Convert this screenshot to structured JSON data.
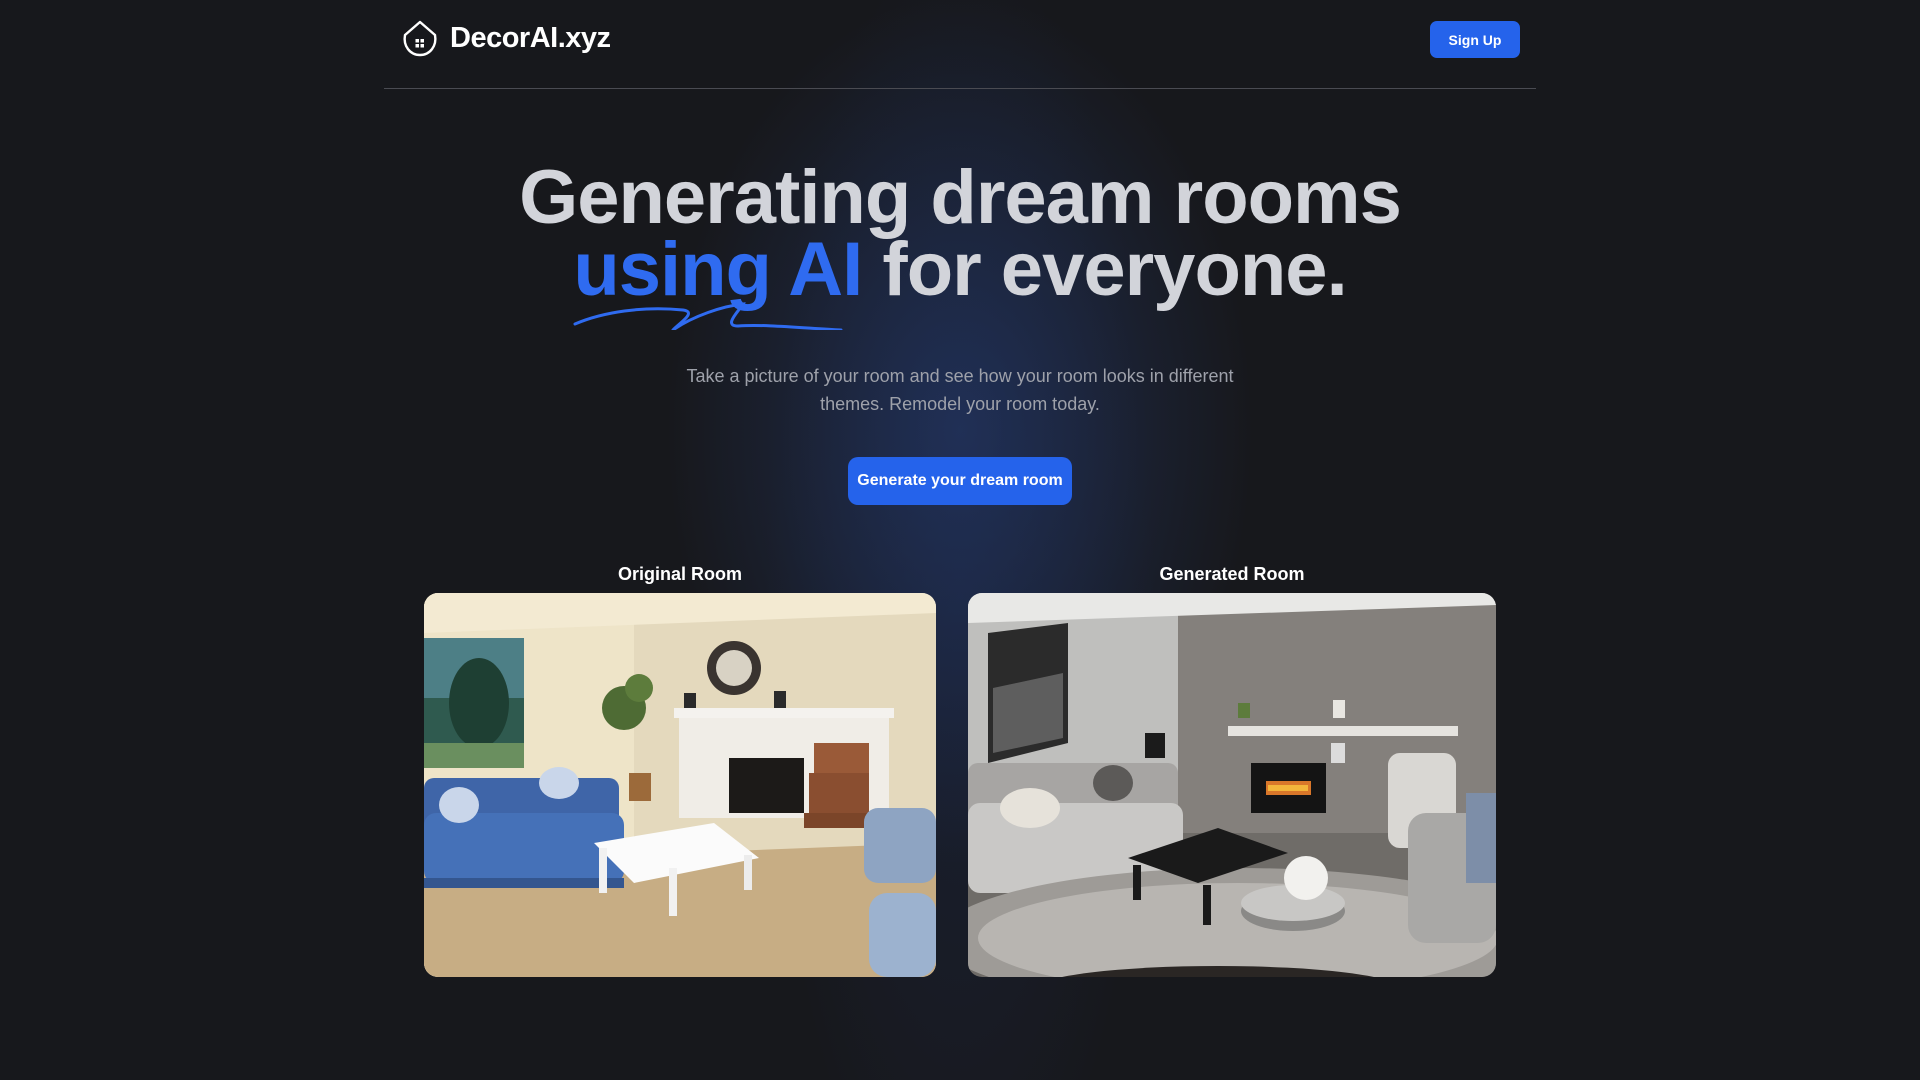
{
  "header": {
    "brand": "DecorAI.xyz",
    "signup_label": "Sign Up"
  },
  "hero": {
    "title_line1": "Generating dream rooms",
    "title_accent": "using AI",
    "title_rest": " for everyone.",
    "subtitle": "Take a picture of your room and see how your room looks in different themes. Remodel your room today.",
    "cta_label": "Generate your dream room"
  },
  "comparison": {
    "original_label": "Original Room",
    "generated_label": "Generated Room"
  },
  "colors": {
    "background": "#17181c",
    "accent": "#2563eb",
    "title": "#d2d4da"
  },
  "icons": {
    "logo": "house-icon"
  }
}
